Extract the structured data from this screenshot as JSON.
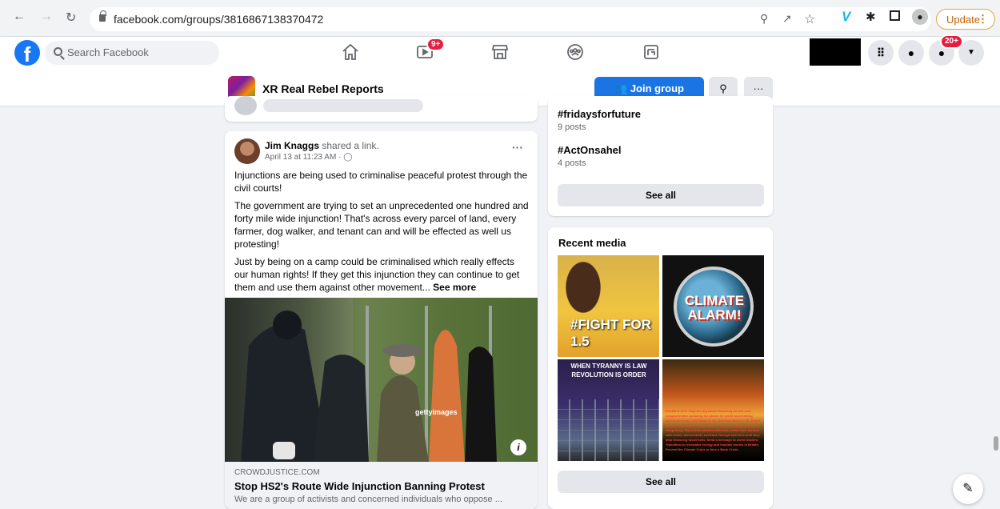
{
  "browser": {
    "url": "facebook.com/groups/3816867138370472",
    "update_label": "Update"
  },
  "fb": {
    "logo": "f",
    "search_placeholder": "Search Facebook",
    "watch_badge": "9+",
    "notif_badge": "20+"
  },
  "group": {
    "name": "XR Real Rebel Reports",
    "join_label": "Join group",
    "more_label": "···"
  },
  "post": {
    "author": "Jim Knaggs",
    "action": "shared a link.",
    "time": "April 13 at 11:23 AM · ",
    "more": "···",
    "paragraphs": [
      "Injunctions are being used to criminalise peaceful protest through the civil courts!",
      "The government are trying to set an unprecedented one hundred and forty mile wide injunction! That's across every parcel of land, every farmer, dog walker, and tenant can and will be effected as well us protesting!",
      "Just by being on a camp could be criminalised which really effects our human rights! If they get this injunction they can continue to get them and use them against other movement... "
    ],
    "see_more": "See more",
    "image_watermark": "gettyimages",
    "link": {
      "domain": "CROWDJUSTICE.COM",
      "title": "Stop HS2's Route Wide Injunction Banning Protest",
      "description": "We are a group of activists and concerned individuals who oppose ..."
    }
  },
  "topics": {
    "items": [
      {
        "tag": "#fridaysforfuture",
        "count": "9 posts"
      },
      {
        "tag": "#ActOnsahel",
        "count": "4 posts"
      }
    ],
    "see_all": "See all"
  },
  "media": {
    "title": "Recent media",
    "thumbs": [
      {
        "text": "#FIGHT FOR 1.5"
      },
      {
        "text": "CLIMATE ALARM!"
      },
      {
        "text": "WHEN TYRANNY IS LAW REVOLUTION IS ORDER"
      },
      {
        "text_red": "STAND & ACT:",
        "text": " Stop the big banks financing oil and coal conglomerates polluting the planet for profit accelerating global warming. Call Chase in US, Barclays Bank in UK, Royal Bank of Canada, Deutsche Bank in Germany, Bank of China in Hong Kong. Block their phones with calls, crash their servers with clicks, demonstrate out front. Disrupt business until they stop financing fossil fuels. Send a message to world leaders: Transition to renewable energy and insulate homes in Britain. Prevent the Climate Crisis or face a Bank Crisis."
      }
    ],
    "see_all": "See all"
  }
}
